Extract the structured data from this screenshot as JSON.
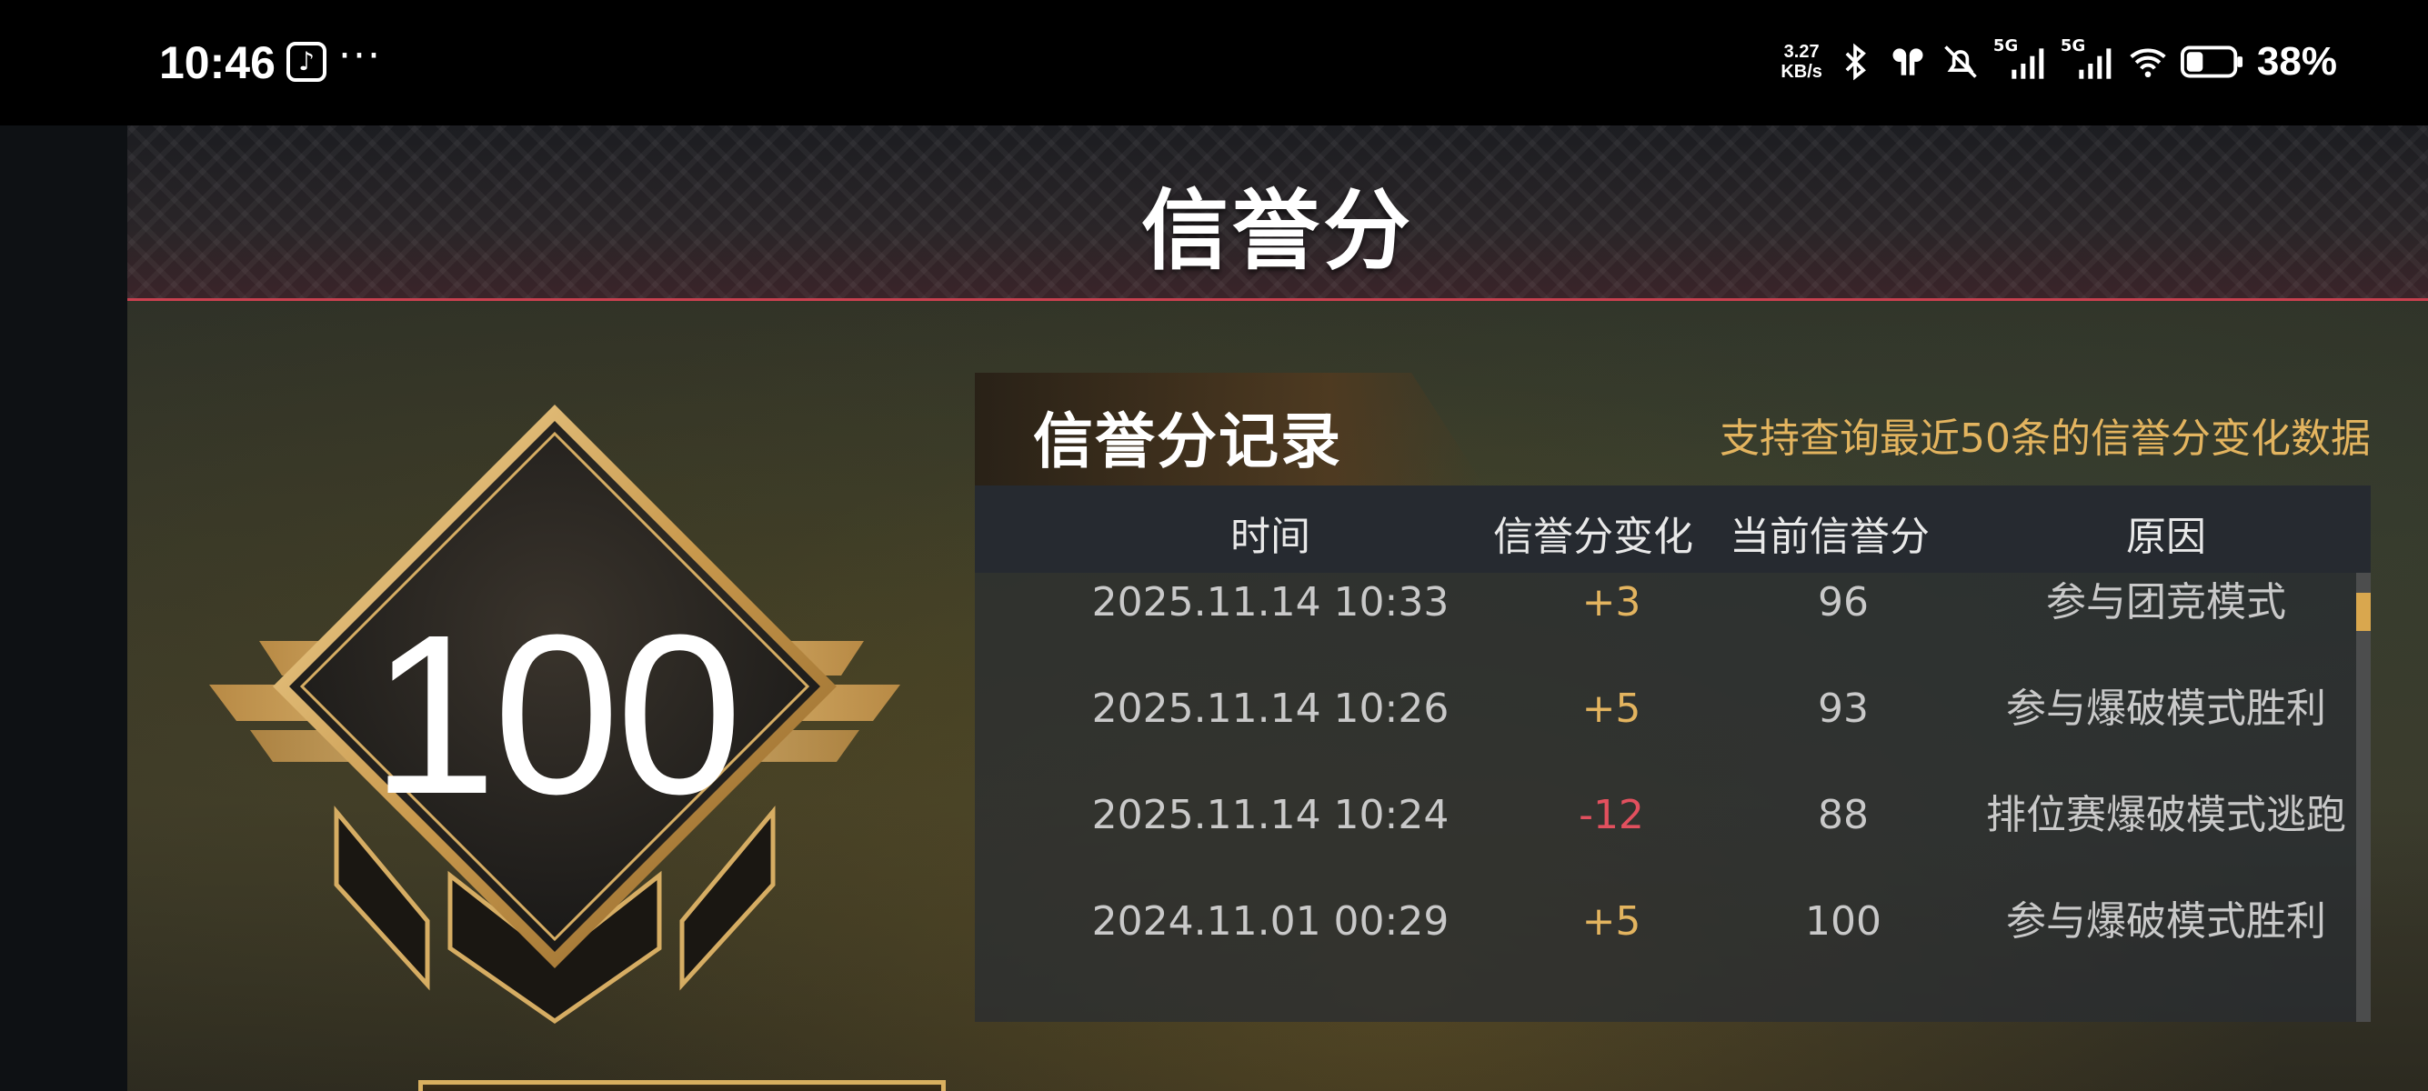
{
  "status_bar": {
    "time": "10:46",
    "speed_value": "3.27",
    "speed_unit": "KB/s",
    "signal_1": "5G",
    "signal_2": "5G",
    "battery": "38%",
    "icons": [
      "tiktok-icon",
      "more-dots-icon",
      "bluetooth-icon",
      "earbuds-icon",
      "mute-icon",
      "signal-icon",
      "wifi-icon",
      "battery-icon"
    ]
  },
  "header": {
    "title": "信誉分"
  },
  "badge": {
    "score": "100"
  },
  "records": {
    "title": "信誉分记录",
    "note": "支持查询最近50条的信誉分变化数据",
    "columns": [
      "时间",
      "信誉分变化",
      "当前信誉分",
      "原因"
    ],
    "rows": [
      {
        "time": "2025.11.14 10:33",
        "change": "+3",
        "current": "96",
        "reason": "参与团竞模式",
        "type": "pos"
      },
      {
        "time": "2025.11.14 10:26",
        "change": "+5",
        "current": "93",
        "reason": "参与爆破模式胜利",
        "type": "pos"
      },
      {
        "time": "2025.11.14 10:24",
        "change": "-12",
        "current": "88",
        "reason": "排位赛爆破模式逃跑",
        "type": "neg"
      },
      {
        "time": "2024.11.01 00:29",
        "change": "+5",
        "current": "100",
        "reason": "参与爆破模式胜利",
        "type": "pos"
      }
    ]
  },
  "colors": {
    "accent_gold": "#e3b45f",
    "negative_red": "#e2505e",
    "header_line": "#c8404f"
  }
}
